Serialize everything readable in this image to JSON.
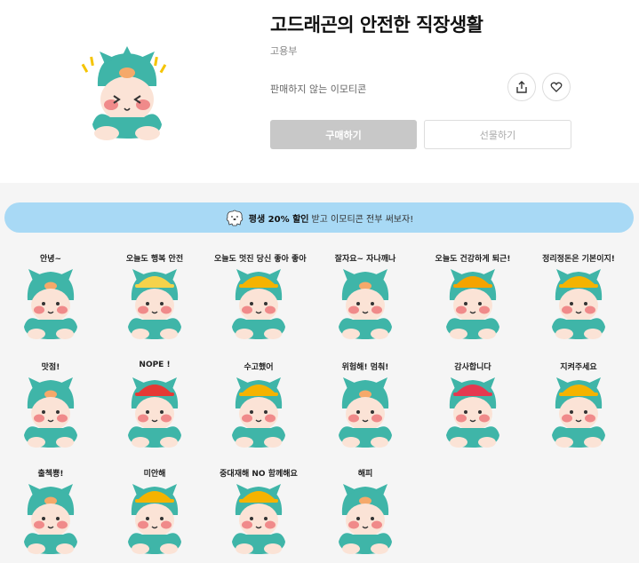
{
  "product": {
    "title": "고드래곤의 안전한 직장생활",
    "author": "고용부",
    "notice": "판매하지 않는 이모티콘",
    "buy_label": "구매하기",
    "gift_label": "선물하기",
    "share_icon": "share-icon",
    "like_icon": "heart-icon"
  },
  "banner": {
    "highlight": "평생 20% 할인",
    "rest": "받고 이모티콘 전부 써보자!",
    "icon": "polar-bear-icon"
  },
  "stickers": [
    {
      "caption": "안녕~",
      "accent": "#f5d24a"
    },
    {
      "caption": "오늘도 행복 안전",
      "accent": "#f5d24a"
    },
    {
      "caption": "오늘도 멋진 당신 좋아 좋아",
      "accent": "#f5b300"
    },
    {
      "caption": "잘자요~ 자나깨나",
      "accent": "#f5b300"
    },
    {
      "caption": "오늘도 건강하게 퇴근!",
      "accent": "#f5a300"
    },
    {
      "caption": "정리정돈은 기본이지!",
      "accent": "#f5b300"
    },
    {
      "caption": "맛점!",
      "accent": "#f5b300"
    },
    {
      "caption": "NOPE !",
      "accent": "#e53935"
    },
    {
      "caption": "수고했어",
      "accent": "#f5b300"
    },
    {
      "caption": "위험해! 멈춰!",
      "accent": "#f5b300"
    },
    {
      "caption": "감사합니다",
      "accent": "#e53950"
    },
    {
      "caption": "지켜주세요",
      "accent": "#f5b300"
    },
    {
      "caption": "출첵뿅!",
      "accent": "#f5c400"
    },
    {
      "caption": "미안해",
      "accent": "#f5b300"
    },
    {
      "caption": "중대재해 NO 함께해요",
      "accent": "#f5b300"
    },
    {
      "caption": "해피",
      "accent": "#f5b300"
    }
  ],
  "colors": {
    "dragon": "#3fb5a8",
    "dragon_dark": "#2a8f84",
    "face": "#fbe3d6",
    "cheek": "#f08a8a",
    "buy_bg": "#c8c8c8",
    "banner_bg": "#a8d9f5",
    "content_bg": "#f5f5f5"
  }
}
